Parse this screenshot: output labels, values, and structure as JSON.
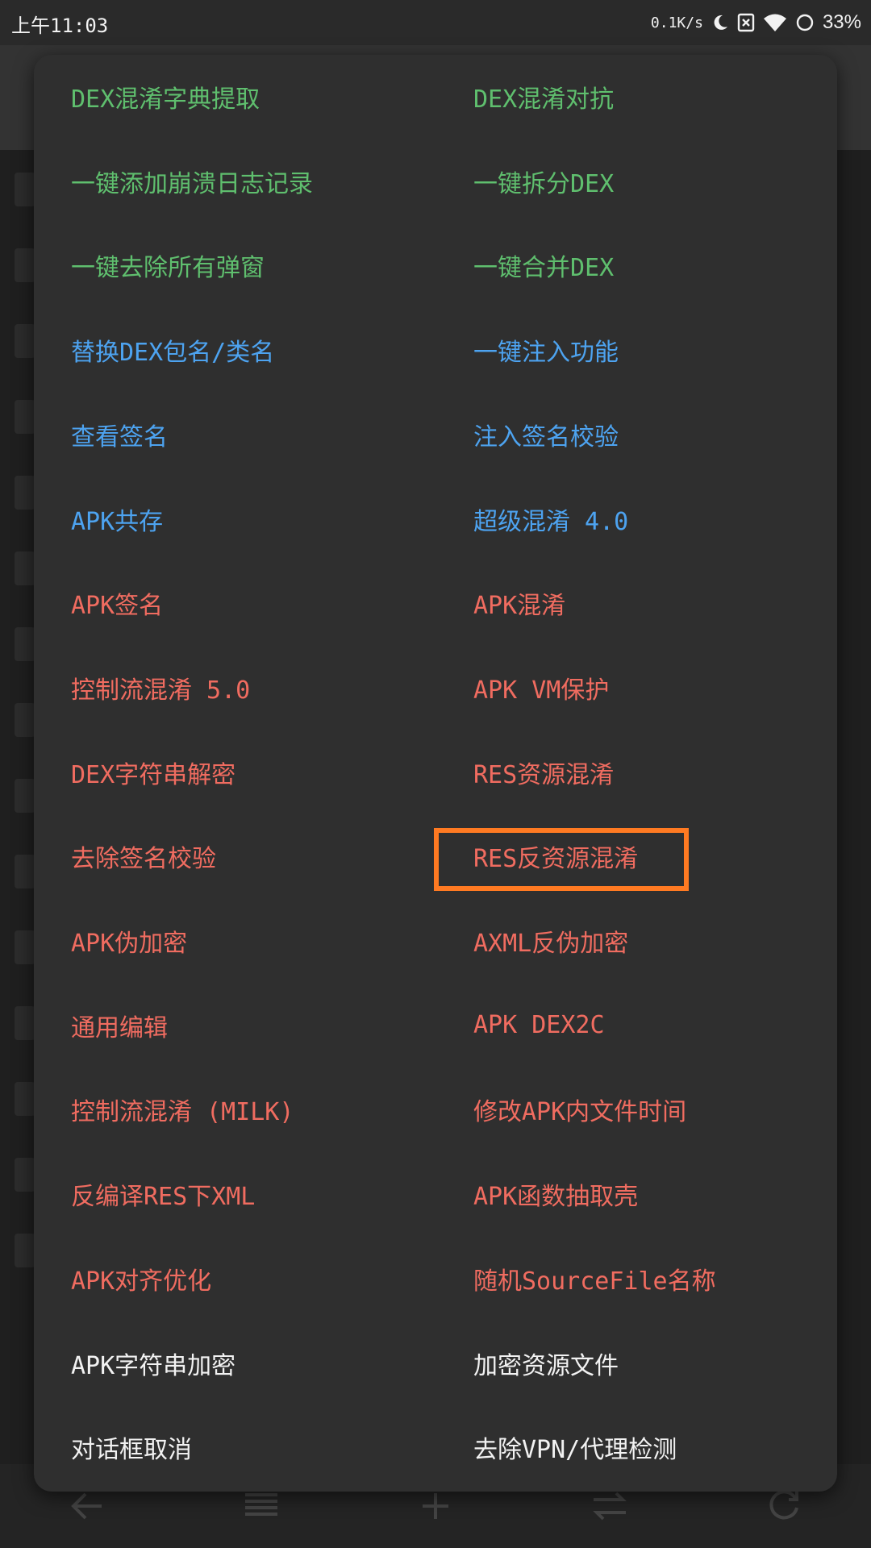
{
  "status_bar": {
    "time": "上午11:03",
    "net_speed": "0.1K/s",
    "battery": "33%"
  },
  "colors": {
    "green": "#5fbf6e",
    "blue": "#4da3f0",
    "red": "#f06c60",
    "white": "#f2f2f2",
    "highlight": "#ff7a22"
  },
  "menu": {
    "items": [
      {
        "label": "DEX混淆字典提取",
        "color": "green"
      },
      {
        "label": "DEX混淆对抗",
        "color": "green"
      },
      {
        "label": "一键添加崩溃日志记录",
        "color": "green"
      },
      {
        "label": "一键拆分DEX",
        "color": "green"
      },
      {
        "label": "一键去除所有弹窗",
        "color": "green"
      },
      {
        "label": "一键合并DEX",
        "color": "green"
      },
      {
        "label": "替换DEX包名/类名",
        "color": "blue"
      },
      {
        "label": "一键注入功能",
        "color": "blue"
      },
      {
        "label": "查看签名",
        "color": "blue"
      },
      {
        "label": "注入签名校验",
        "color": "blue"
      },
      {
        "label": "APK共存",
        "color": "blue"
      },
      {
        "label": "超级混淆 4.0",
        "color": "blue"
      },
      {
        "label": "APK签名",
        "color": "red"
      },
      {
        "label": "APK混淆",
        "color": "red"
      },
      {
        "label": "控制流混淆 5.0",
        "color": "red"
      },
      {
        "label": "APK VM保护",
        "color": "red"
      },
      {
        "label": "DEX字符串解密",
        "color": "red"
      },
      {
        "label": "RES资源混淆",
        "color": "red"
      },
      {
        "label": "去除签名校验",
        "color": "red"
      },
      {
        "label": "RES反资源混淆",
        "color": "red",
        "highlighted": true
      },
      {
        "label": "APK伪加密",
        "color": "red"
      },
      {
        "label": "AXML反伪加密",
        "color": "red"
      },
      {
        "label": "通用编辑",
        "color": "red"
      },
      {
        "label": "APK DEX2C",
        "color": "red"
      },
      {
        "label": "控制流混淆 (MILK)",
        "color": "red"
      },
      {
        "label": "修改APK内文件时间",
        "color": "red"
      },
      {
        "label": "反编译RES下XML",
        "color": "red"
      },
      {
        "label": "APK函数抽取壳",
        "color": "red"
      },
      {
        "label": "APK对齐优化",
        "color": "red"
      },
      {
        "label": "随机SourceFile名称",
        "color": "red"
      },
      {
        "label": "APK字符串加密",
        "color": "white"
      },
      {
        "label": "加密资源文件",
        "color": "white"
      },
      {
        "label": "对话框取消",
        "color": "white"
      },
      {
        "label": "去除VPN/代理检测",
        "color": "white"
      }
    ]
  },
  "bottom_bar": {
    "icons": [
      "back-arrow-icon",
      "menu-lines-icon",
      "plus-icon",
      "swap-icon",
      "refresh-icon"
    ]
  }
}
